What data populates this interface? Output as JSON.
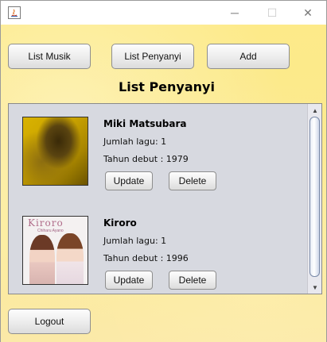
{
  "window": {
    "minimize_glyph": "─",
    "maximize_glyph": "☐",
    "close_glyph": "✕"
  },
  "nav": {
    "list_musik": "List Musik",
    "list_penyanyi": "List Penyanyi",
    "add": "Add"
  },
  "heading": "List Penyanyi",
  "singers": [
    {
      "name": "Miki Matsubara",
      "songs": "Jumlah lagu: 1",
      "debut": "Tahun debut : 1979",
      "update_label": "Update",
      "delete_label": "Delete"
    },
    {
      "name": "Kiroro",
      "songs": "Jumlah lagu: 1",
      "debut": "Tahun debut : 1996",
      "update_label": "Update",
      "delete_label": "Delete",
      "cover_text": "Kiroro",
      "cover_subtext": "Chiharu Ayano"
    }
  ],
  "logout": "Logout",
  "scrollbar": {
    "up_glyph": "▲",
    "down_glyph": "▼"
  }
}
